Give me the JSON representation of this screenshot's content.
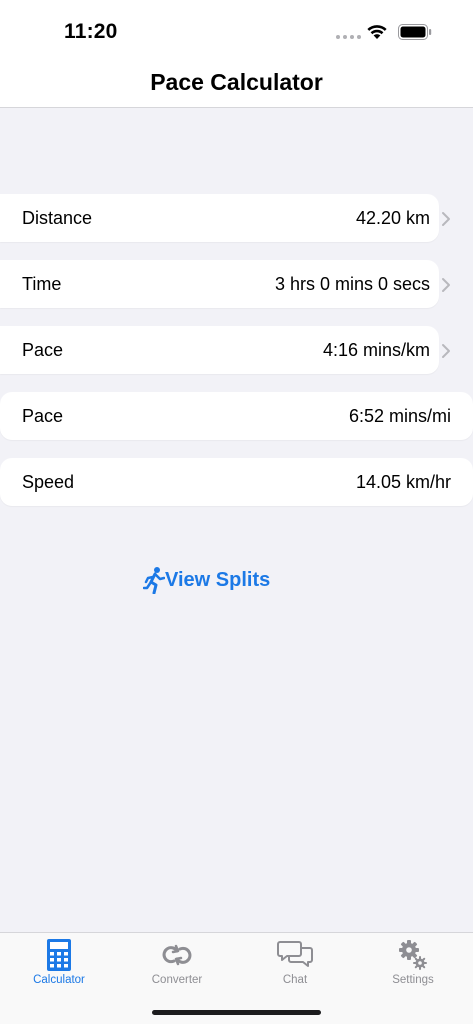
{
  "status_bar": {
    "time": "11:20"
  },
  "nav": {
    "title": "Pace Calculator"
  },
  "rows": [
    {
      "label": "Distance",
      "value": "42.20 km",
      "chevron": true
    },
    {
      "label": "Time",
      "value": "3 hrs 0 mins 0 secs",
      "chevron": true
    },
    {
      "label": "Pace",
      "value": "4:16 mins/km",
      "chevron": true
    },
    {
      "label": "Pace",
      "value": "6:52 mins/mi",
      "chevron": false
    },
    {
      "label": "Speed",
      "value": "14.05 km/hr",
      "chevron": false
    }
  ],
  "splits_button": {
    "label": "View Splits",
    "icon": "runner-icon"
  },
  "tabs": [
    {
      "label": "Calculator",
      "icon": "calculator-icon",
      "active": true
    },
    {
      "label": "Converter",
      "icon": "converter-icon",
      "active": false
    },
    {
      "label": "Chat",
      "icon": "chat-icon",
      "active": false
    },
    {
      "label": "Settings",
      "icon": "settings-icon",
      "active": false
    }
  ],
  "colors": {
    "accent": "#1c79e6",
    "inactive": "#8e8e93",
    "background": "#f2f2f7"
  }
}
